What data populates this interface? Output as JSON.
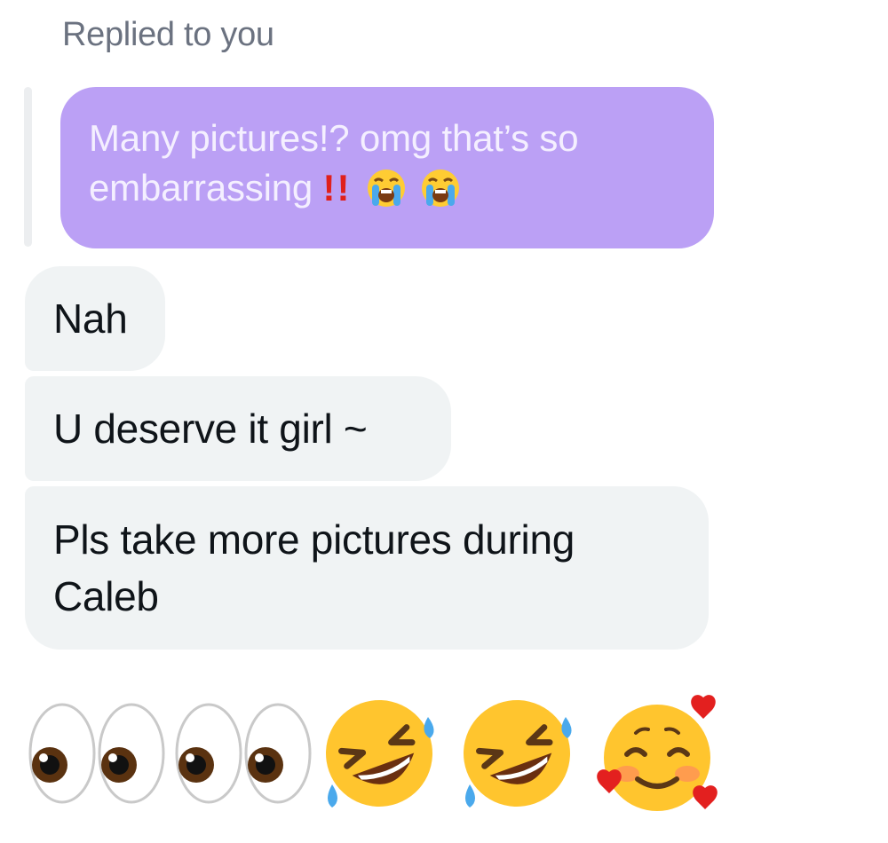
{
  "reply_context": {
    "label": "Replied to you",
    "quoted_text": "Many pictures!? omg that’s so embarrassing",
    "quoted_suffix": "‼️",
    "quoted_emojis": [
      "loudly-crying-face",
      "loudly-crying-face"
    ],
    "bubble_color": "#bba0f5"
  },
  "messages": [
    {
      "text": "Nah"
    },
    {
      "text": "U deserve it girl ~"
    },
    {
      "text": "Pls take more pictures during Caleb"
    }
  ],
  "emoji_reply": [
    "eyes",
    "eyes",
    "rolling-on-the-floor-laughing",
    "rolling-on-the-floor-laughing",
    "smiling-face-with-hearts"
  ],
  "colors": {
    "received_bubble": "#f0f3f4",
    "text_primary": "#0f1419",
    "text_secondary": "#6b7280"
  }
}
